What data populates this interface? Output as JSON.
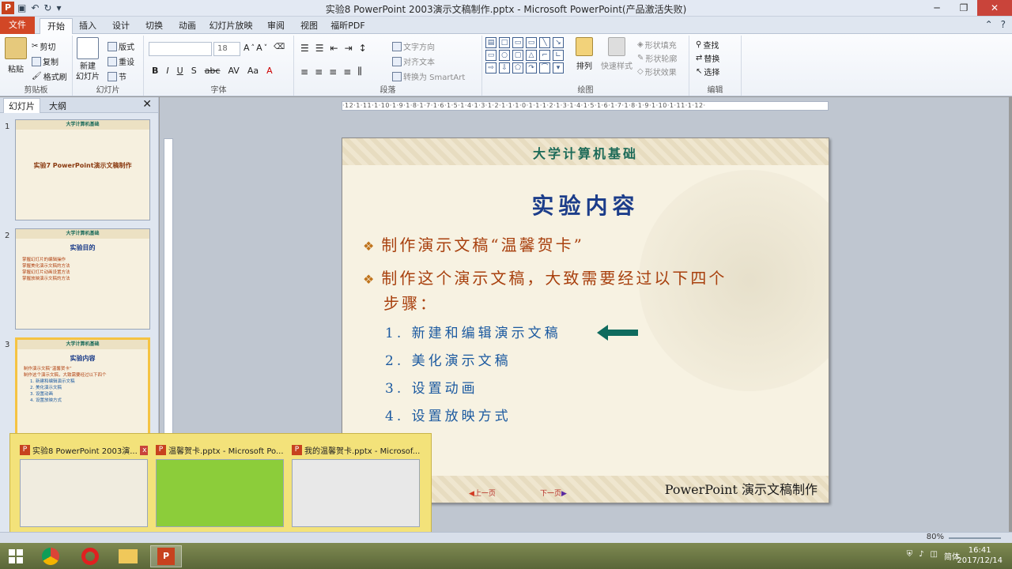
{
  "window": {
    "title": "实验8 PowerPoint 2003演示文稿制作.pptx - Microsoft PowerPoint(产品激活失败)"
  },
  "tabs": [
    "文件",
    "开始",
    "插入",
    "设计",
    "切换",
    "动画",
    "幻灯片放映",
    "审阅",
    "视图",
    "福昕PDF"
  ],
  "ribbon": {
    "clipboard": {
      "paste": "粘贴",
      "cut": "剪切",
      "copy": "复制",
      "format_painter": "格式刷",
      "label": "剪贴板"
    },
    "slides": {
      "new_slide": "新建",
      "new_slide2": "幻灯片",
      "layout": "版式",
      "reset": "重设",
      "section": "节",
      "label": "幻灯片"
    },
    "font": {
      "label": "字体",
      "size": "18"
    },
    "paragraph": {
      "text_direction": "文字方向",
      "align_text": "对齐文本",
      "smartart": "转换为 SmartArt",
      "label": "段落"
    },
    "drawing": {
      "arrange": "排列",
      "quick_styles": "快速样式",
      "fill": "形状填充",
      "outline": "形状轮廓",
      "effects": "形状效果",
      "label": "绘图"
    },
    "editing": {
      "find": "查找",
      "replace": "替换",
      "select": "选择",
      "label": "编辑"
    }
  },
  "leftpanel": {
    "tab_slides": "幻灯片",
    "tab_outline": "大纲",
    "thumbs": [
      {
        "num": "1",
        "header": "大学计算机基础",
        "title": "实验7 PowerPoint演示文稿制作"
      },
      {
        "num": "2",
        "header": "大学计算机基础",
        "title": "实验目的",
        "lines": [
          "掌握幻灯片的编辑操作",
          "掌握美化演示文稿的方法",
          "掌握幻灯片动画设置方法",
          "掌握放映演示文稿的方法"
        ]
      },
      {
        "num": "3",
        "header": "大学计算机基础",
        "title": "实验内容"
      }
    ]
  },
  "ruler": {
    "marks": "·12·1·11·1·10·1·9·1·8·1·7·1·6·1·5·1·4·1·3·1·2·1·1·1·0·1·1·1·2·1·3·1·4·1·5·1·6·1·7·1·8·1·9·1·10·1·11·1·12·"
  },
  "slide": {
    "header": "大学计算机基础",
    "title": "实验内容",
    "bullet1": "制作演示文稿“温馨贺卡”",
    "bullet2a": "制作这个演示文稿，大致需要经过以下四个",
    "bullet2b": "步骤：",
    "steps": [
      "1.  新建和编辑演示文稿",
      "2.  美化演示文稿",
      "3.  设置动画",
      "4.  设置放映方式"
    ],
    "prev": "上一页",
    "next": "下一页",
    "footer": "PowerPoint 演示文稿制作",
    "arrow_color": "#0f6b5e"
  },
  "previews": [
    {
      "title": "实验8 PowerPoint 2003演...",
      "close": "x"
    },
    {
      "title": "温馨贺卡.pptx - Microsoft Po..."
    },
    {
      "title": "我的温馨贺卡.pptx - Microsof..."
    }
  ],
  "status": {
    "zoom": "80%"
  },
  "taskbar": {
    "time": "16:41",
    "date": "2017/12/14",
    "ime": "简体"
  }
}
